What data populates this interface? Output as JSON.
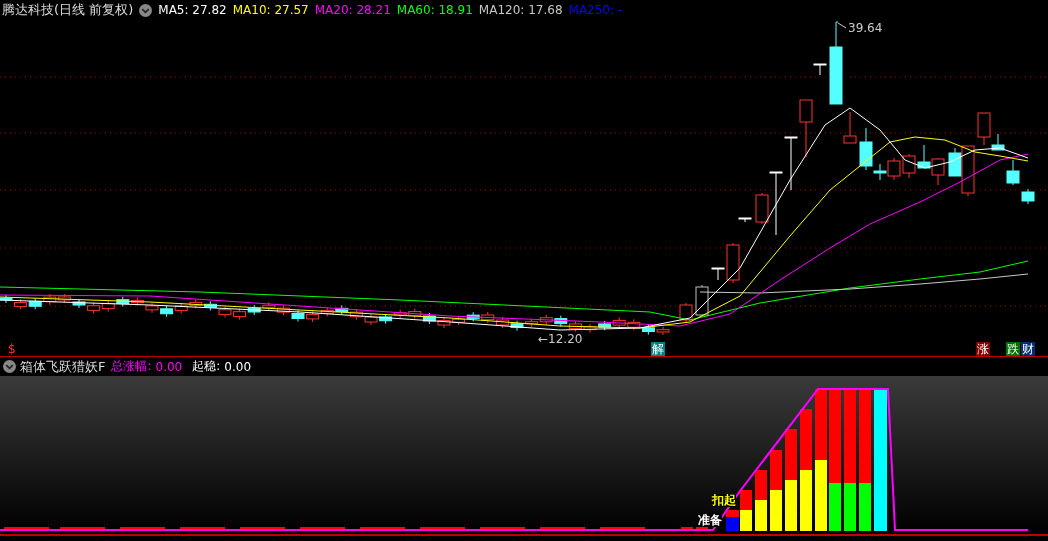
{
  "header": {
    "title": "腾达科技(日线 前复权)",
    "ma": [
      {
        "label": "MA5: 27.82",
        "color": "#ffffff"
      },
      {
        "label": "MA10: 27.57",
        "color": "#ffff00"
      },
      {
        "label": "MA20: 28.21",
        "color": "#ff00ff"
      },
      {
        "label": "MA60: 18.91",
        "color": "#00ff00"
      },
      {
        "label": "MA120: 17.68",
        "color": "#c8c8c8"
      },
      {
        "label": "MA250: -",
        "color": "#0000ff"
      }
    ]
  },
  "main_chart": {
    "high_label": "39.64",
    "low_label": "←12.20",
    "markers": [
      {
        "text": "$",
        "kind": "text",
        "color": "#ff3232"
      },
      {
        "text": "解",
        "kind": "badge",
        "color": "#008080"
      },
      {
        "text": "涨",
        "kind": "badge",
        "color": "#800000"
      },
      {
        "text": "跌",
        "kind": "badge",
        "color": "#007000"
      },
      {
        "text": "财",
        "kind": "badge",
        "color": "#003070"
      }
    ]
  },
  "indicator": {
    "name": "箱体飞跃猎妖F",
    "stats": [
      {
        "label": "总涨幅:",
        "value": "0.00",
        "color": "#ff00ff"
      },
      {
        "label": "起稳:",
        "value": "0.00",
        "color": "#ffffff"
      }
    ],
    "signals": [
      {
        "text": "扣起",
        "color": "#ffff00"
      },
      {
        "text": "准备",
        "color": "#ffffff"
      }
    ]
  }
}
